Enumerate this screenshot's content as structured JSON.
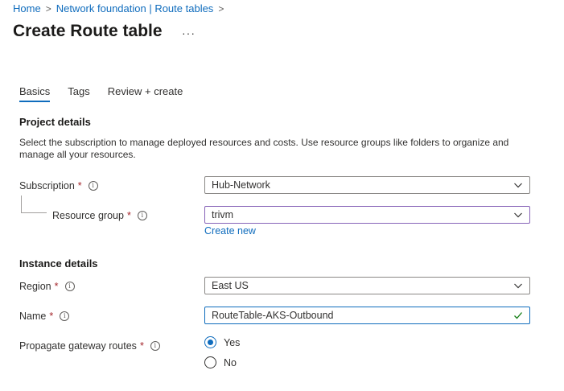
{
  "breadcrumb": {
    "home": "Home",
    "parent": "Network foundation | Route tables",
    "separator": ">"
  },
  "page": {
    "title": "Create Route table",
    "more": "···"
  },
  "tabs": [
    {
      "label": "Basics",
      "active": true
    },
    {
      "label": "Tags",
      "active": false
    },
    {
      "label": "Review + create",
      "active": false
    }
  ],
  "project": {
    "heading": "Project details",
    "description": "Select the subscription to manage deployed resources and costs. Use resource groups like folders to organize and manage all your resources.",
    "subscription": {
      "label": "Subscription",
      "required": "*",
      "value": "Hub-Network"
    },
    "resource_group": {
      "label": "Resource group",
      "required": "*",
      "value": "trivm",
      "create_new": "Create new"
    }
  },
  "instance": {
    "heading": "Instance details",
    "region": {
      "label": "Region",
      "required": "*",
      "value": "East US"
    },
    "name": {
      "label": "Name",
      "required": "*",
      "value": "RouteTable-AKS-Outbound"
    },
    "propagate": {
      "label": "Propagate gateway routes",
      "required": "*",
      "options": [
        "Yes",
        "No"
      ],
      "selected": "Yes"
    }
  },
  "icons": {
    "info": "info-icon",
    "chevron": "chevron-down-icon",
    "check": "checkmark-icon"
  },
  "colors": {
    "accent": "#0f6cbd",
    "required": "#a4262c",
    "focus_border": "#8764b8",
    "valid_check": "#107c10"
  }
}
